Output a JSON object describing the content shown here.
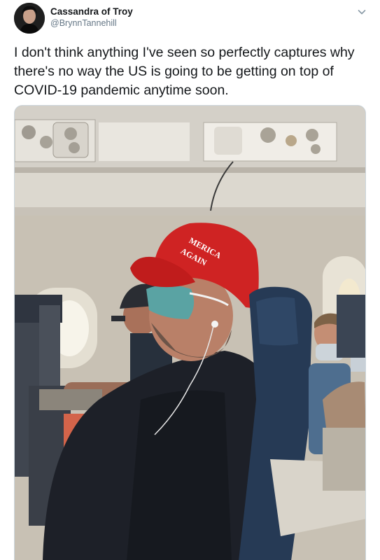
{
  "tweet": {
    "author_name": "Cassandra of Troy",
    "author_handle": "@BrynnTannehill",
    "text": "I don't think anything I've seen so perfectly captures why there's no way the US is going to be getting on top of COVID-19 pandemic anytime soon.",
    "more_icon": "chevron-down-icon"
  },
  "photo": {
    "hat_text_line1": "MERICA",
    "hat_text_line2": "AGAIN"
  }
}
